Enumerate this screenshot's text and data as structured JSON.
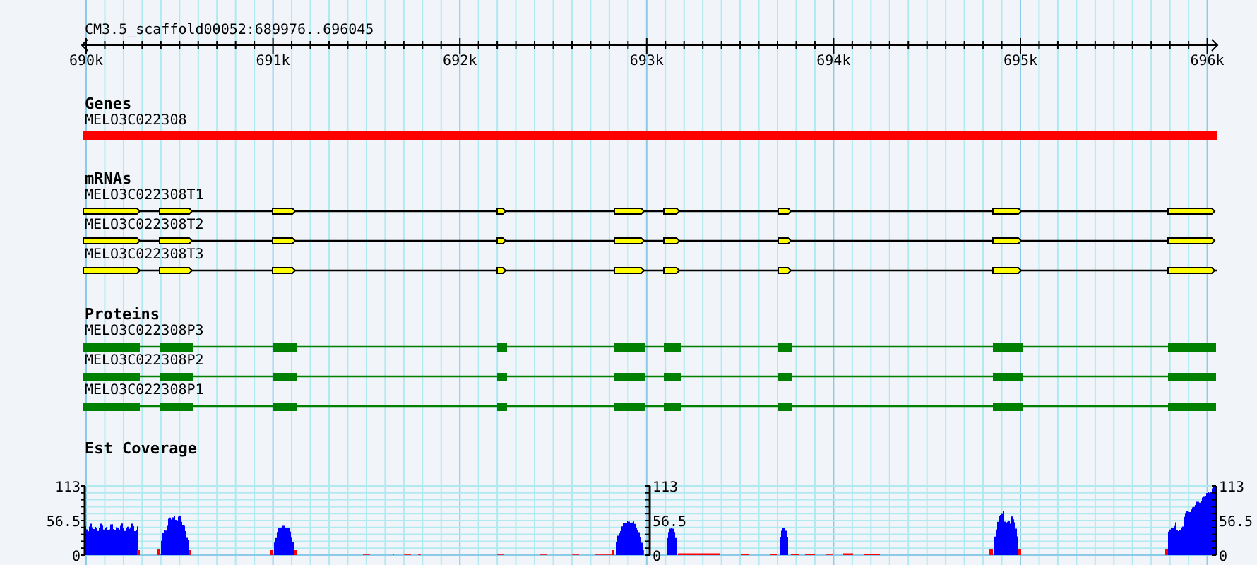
{
  "ruler": {
    "region": "CM3.5_scaffold00052:689976..696045",
    "ticks": [
      "690k",
      "691k",
      "692k",
      "693k",
      "694k",
      "695k",
      "696k"
    ]
  },
  "tracks": [
    {
      "kind": "gene",
      "title": "Genes",
      "features": [
        {
          "name": "MELO3C022308"
        }
      ]
    },
    {
      "kind": "mrna",
      "title": "mRNAs",
      "features": [
        {
          "name": "MELO3C022308T1"
        },
        {
          "name": "MELO3C022308T2"
        },
        {
          "name": "MELO3C022308T3"
        }
      ]
    },
    {
      "kind": "protein",
      "title": "Proteins",
      "features": [
        {
          "name": "MELO3C022308P3"
        },
        {
          "name": "MELO3C022308P2"
        },
        {
          "name": "MELO3C022308P1"
        }
      ]
    },
    {
      "kind": "coverage",
      "title": "Est Coverage",
      "axes": [
        {
          "labels": [
            "113",
            "56.5",
            "0"
          ]
        },
        {
          "labels": [
            "113",
            "56.5",
            "0"
          ]
        },
        {
          "labels": [
            "113",
            "56.5",
            "0"
          ]
        }
      ]
    }
  ]
}
